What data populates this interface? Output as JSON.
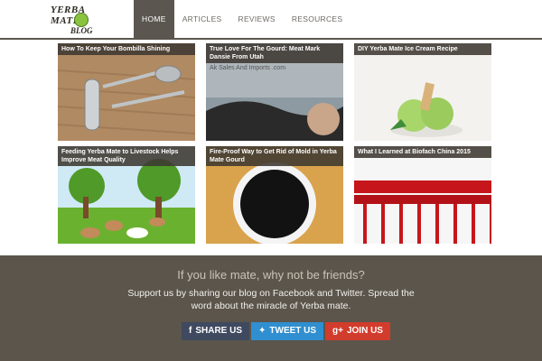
{
  "logo": {
    "line1": "YERBA MATE",
    "line2": "BLOG"
  },
  "nav": {
    "items": [
      {
        "label": "HOME"
      },
      {
        "label": "ARTICLES"
      },
      {
        "label": "REVIEWS"
      },
      {
        "label": "RESOURCES"
      }
    ]
  },
  "posts": [
    {
      "title": "How To Keep Your Bombilla Shining"
    },
    {
      "title": "True Love For The Gourd: Meat Mark Dansie From Utah",
      "image_caption": "Ak Sales And Imports .com"
    },
    {
      "title": "DIY Yerba Mate Ice Cream Recipe"
    },
    {
      "title": "Feeding Yerba Mate to Livestock Helps Improve Meat Quality"
    },
    {
      "title": "Fire-Proof Way to Get Rid of Mold in Yerba Mate Gourd"
    },
    {
      "title": "What I Learned at Biofach China 2015"
    }
  ],
  "footer": {
    "heading": "If you like mate, why not be friends?",
    "text": "Support us by sharing our blog on Facebook and Twitter. Spread the word about the miracle of Yerba mate.",
    "buttons": {
      "share": "SHARE US",
      "tweet": "TWEET US",
      "join": "JOIN US"
    }
  }
}
